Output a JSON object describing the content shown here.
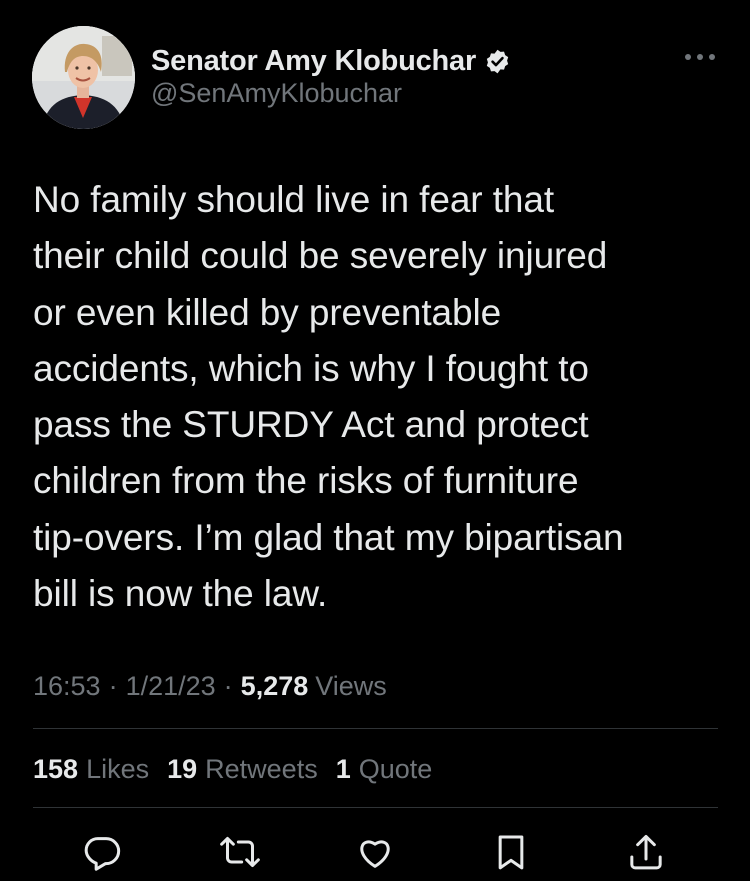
{
  "author": {
    "display_name": "Senator Amy Klobuchar",
    "handle": "@SenAmyKlobuchar",
    "verified": true
  },
  "tweet": {
    "text": "No family should live in fear that\ntheir child could be severely injured\nor even killed by preventable\naccidents, which is why I fought to\npass the STURDY Act and protect\nchildren from the risks of furniture\ntip-overs. I’m glad that my bipartisan\nbill is now the law.",
    "time": "16:53",
    "date": "1/21/23",
    "separator": "·",
    "views_count": "5,278",
    "views_label": "Views"
  },
  "stats": {
    "likes_count": "158",
    "likes_label": "Likes",
    "retweets_count": "19",
    "retweets_label": "Retweets",
    "quotes_count": "1",
    "quotes_label": "Quote"
  },
  "icons": {
    "more": "more-horizontal-icon",
    "verified": "verified-badge-icon",
    "reply": "reply-icon",
    "retweet": "retweet-icon",
    "like": "heart-icon",
    "bookmark": "bookmark-icon",
    "share": "share-icon"
  },
  "colors": {
    "background": "#000000",
    "primary_text": "#e7e9ea",
    "secondary_text": "#71767b",
    "divider": "#2f3336",
    "verified_badge": "#e7e9ea"
  }
}
